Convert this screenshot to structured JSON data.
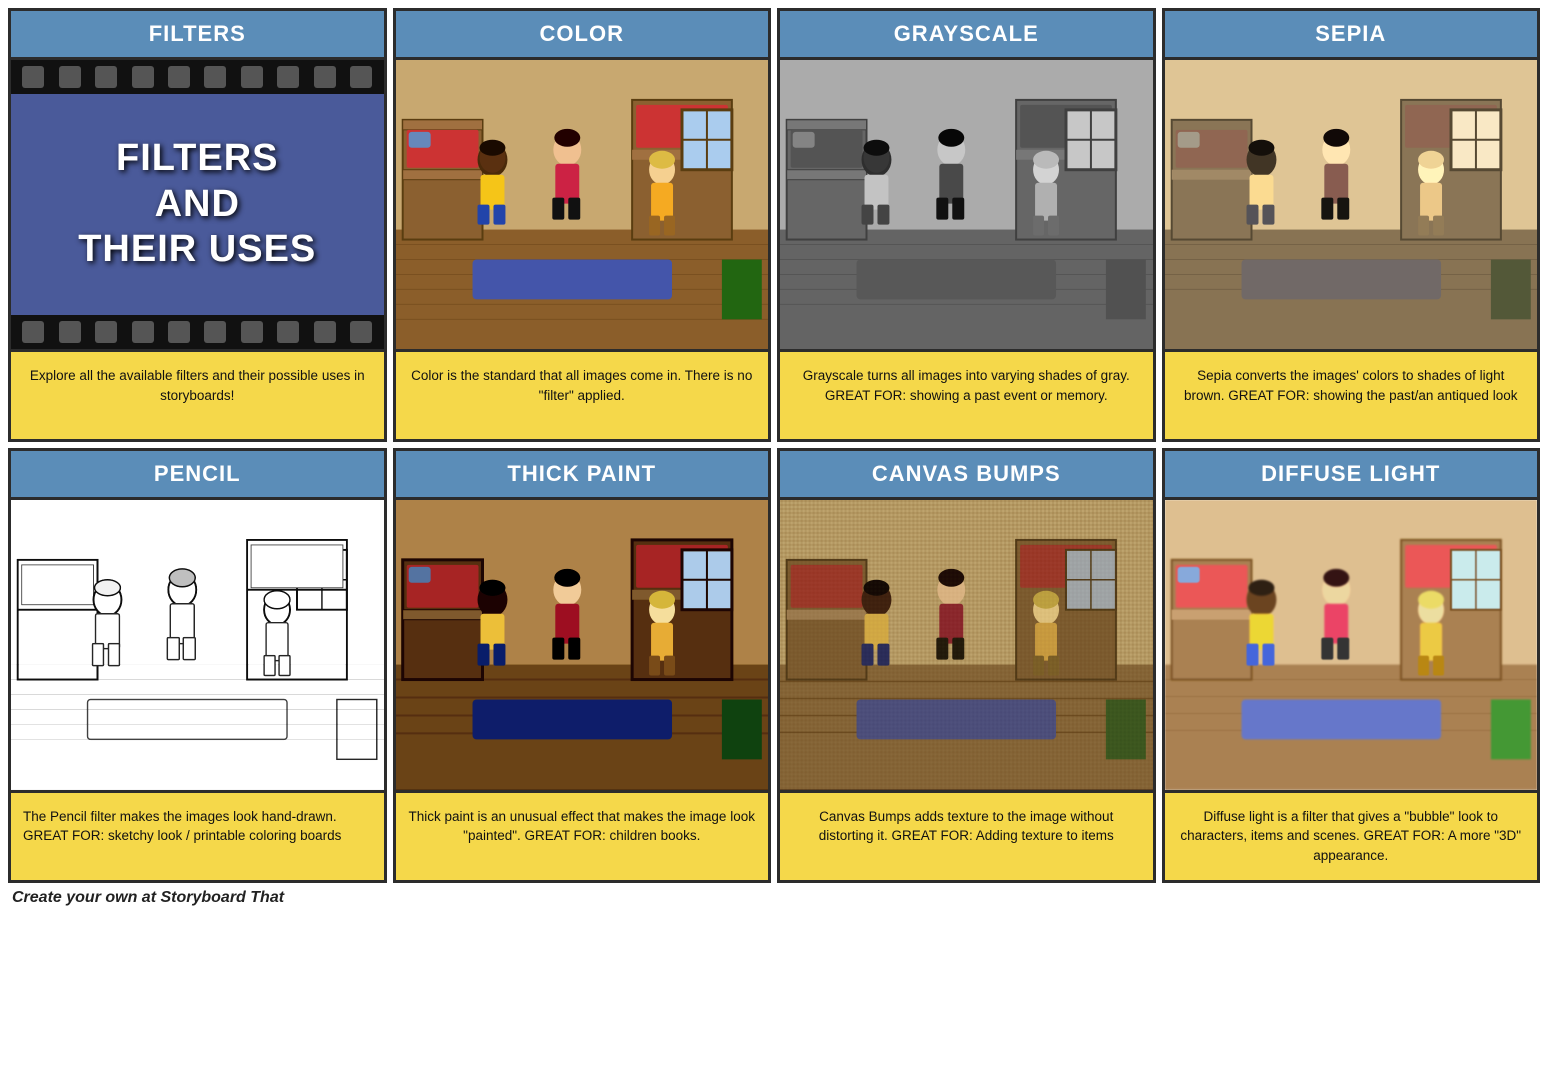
{
  "row1": [
    {
      "id": "filters",
      "header": "FILTERS",
      "type": "title",
      "desc": "Explore all the available filters and their possible uses in storyboards!"
    },
    {
      "id": "color",
      "header": "COLOR",
      "type": "scene-color",
      "desc": "Color is the standard that all images come in. There is no \"filter\" applied."
    },
    {
      "id": "grayscale",
      "header": "GRAYSCALE",
      "type": "scene-grayscale",
      "desc": "Grayscale turns all images into varying shades of gray.\n\nGREAT FOR: showing a past event or memory."
    },
    {
      "id": "sepia",
      "header": "SEPIA",
      "type": "scene-sepia",
      "desc": "Sepia converts the images' colors to shades of light brown.\n\nGREAT FOR: showing the past/an antiqued look"
    }
  ],
  "row2": [
    {
      "id": "pencil",
      "header": "PENCIL",
      "type": "scene-pencil",
      "desc": "The Pencil filter makes the images look hand-drawn.\n\nGREAT FOR: sketchy look / printable coloring boards"
    },
    {
      "id": "thickpaint",
      "header": "THICK PAINT",
      "type": "scene-thickpaint",
      "desc": "Thick paint is an unusual effect that makes the image look \"painted\".\n\nGREAT FOR: children books."
    },
    {
      "id": "canvasbumps",
      "header": "CANVAS BUMPS",
      "type": "scene-canvasbumps",
      "desc": "Canvas Bumps adds texture to the image without distorting it.\n\nGREAT FOR: Adding texture to items"
    },
    {
      "id": "diffuse",
      "header": "DIFFUSE LIGHT",
      "type": "scene-diffuse",
      "desc": "Diffuse light is a filter that gives a \"bubble\" look to characters, items and scenes.\n\nGREAT FOR: A more \"3D\" appearance."
    }
  ],
  "footer": "Create your own at Storyboard That"
}
